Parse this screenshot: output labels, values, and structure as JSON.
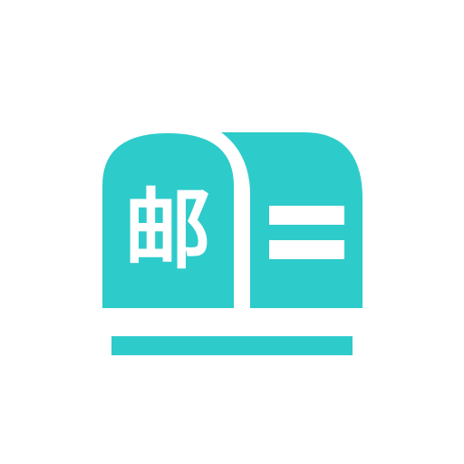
{
  "icon": {
    "name": "mailbox-icon",
    "character": "邮",
    "colors": {
      "primary": "#2ecbcb",
      "background": "#ffffff",
      "glyph": "#ffffff"
    }
  }
}
